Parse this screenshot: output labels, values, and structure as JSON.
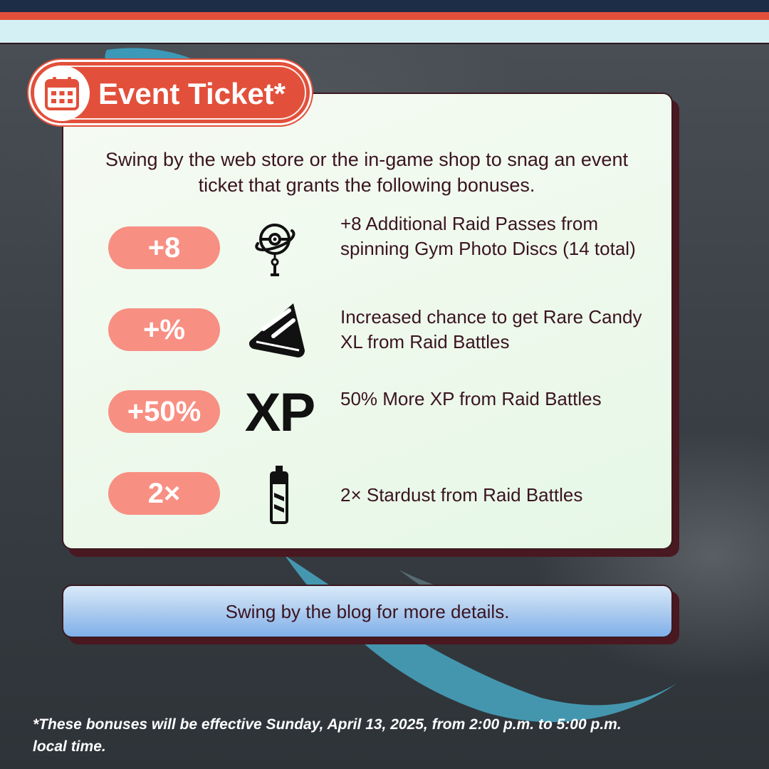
{
  "badge": {
    "title": "Event Ticket*",
    "icon": "calendar-icon"
  },
  "intro": "Swing by the web store or the in-game shop to snag an event ticket that grants the following bonuses.",
  "bonuses": [
    {
      "pill": "+8",
      "icon": "raid-pass-icon",
      "text": "+8 Additional Raid Passes from spinning Gym Photo Discs (14 total)"
    },
    {
      "pill": "+%",
      "icon": "rare-candy-xl-icon",
      "text": "Increased chance to get Rare Candy XL from Raid Battles"
    },
    {
      "pill": "+50%",
      "icon": "xp-icon",
      "icon_text": "XP",
      "text": "50% More XP from Raid Battles"
    },
    {
      "pill": "2×",
      "icon": "stardust-icon",
      "text": "2× Stardust from Raid Battles"
    }
  ],
  "cta": "Swing by the blog for more details.",
  "footnote": "*These bonuses will be effective Sunday, April 13, 2025, from 2:00 p.m. to 5:00 p.m. local time.",
  "colors": {
    "accent_red": "#e2503b",
    "navy": "#1e2d47",
    "pill": "#f88f83",
    "text_dark": "#3a1420"
  }
}
